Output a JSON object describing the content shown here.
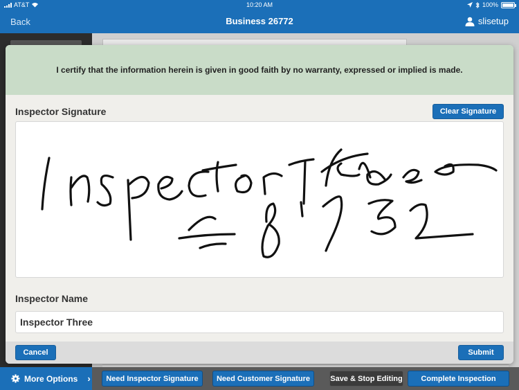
{
  "status_bar": {
    "carrier": "AT&T",
    "time": "10:20 AM",
    "battery": "100%"
  },
  "nav": {
    "back_label": "Back",
    "title": "Business 26772",
    "user": "slisetup"
  },
  "modal": {
    "certification_text": "I certify that the information herein is given in good faith by no warranty, expressed or implied is made.",
    "signature_label": "Inspector Signature",
    "clear_signature_label": "Clear Signature",
    "name_label": "Inspector Name",
    "name_value": "Inspector Three",
    "cancel_label": "Cancel",
    "submit_label": "Submit"
  },
  "toolbar": {
    "more_options_label": "More Options",
    "need_inspector_signature_label": "Need Inspector Signature",
    "need_customer_signature_label": "Need Customer Signature",
    "save_stop_editing_label": "Save & Stop Editing",
    "complete_inspection_label": "Complete Inspection"
  },
  "colors": {
    "primary_blue": "#1b6fb8",
    "cert_banner": "#c9dcc8",
    "modal_bg": "#f0efeb"
  },
  "icons": {
    "wifi": "wifi-icon",
    "location": "location-arrow-icon",
    "bluetooth": "bluetooth-icon",
    "user": "user-icon",
    "gear": "gear-icon",
    "chevron": "chevron-right-icon"
  }
}
